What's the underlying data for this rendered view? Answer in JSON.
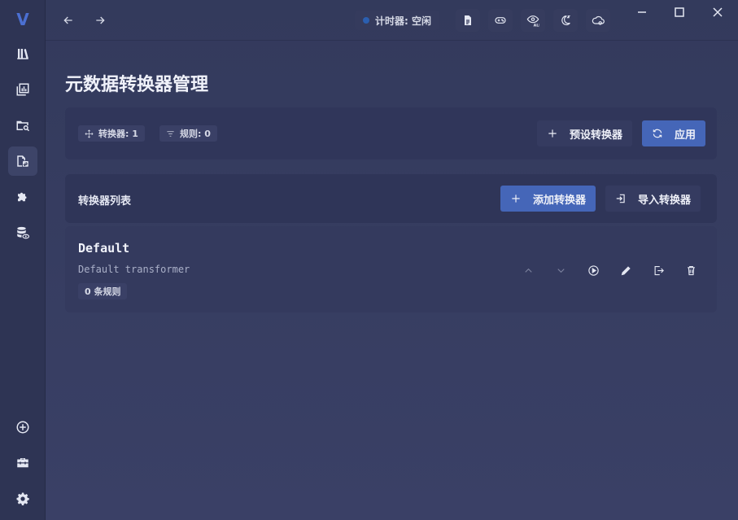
{
  "app": {
    "logo": "V"
  },
  "topbar": {
    "timer_label": "计时器: 空闲"
  },
  "sidebar": {
    "items": [
      {
        "icon": "library-icon"
      },
      {
        "icon": "stats-icon"
      },
      {
        "icon": "folder-search-icon"
      },
      {
        "icon": "file-transform-icon"
      },
      {
        "icon": "puzzle-icon"
      },
      {
        "icon": "database-eye-icon"
      }
    ],
    "bottom": [
      {
        "icon": "plus-circle-icon"
      },
      {
        "icon": "toolbox-icon"
      },
      {
        "icon": "gear-icon"
      }
    ]
  },
  "page": {
    "title": "元数据转换器管理",
    "stats": {
      "transformers_label": "转换器: 1",
      "rules_label": "规则: 0"
    },
    "preset_button": "预设转换器",
    "apply_button": "应用",
    "list": {
      "title": "转换器列表",
      "add_button": "添加转换器",
      "import_button": "导入转换器"
    },
    "items": [
      {
        "name": "Default",
        "description": "Default transformer",
        "rules_badge": "0 条规则"
      }
    ]
  }
}
